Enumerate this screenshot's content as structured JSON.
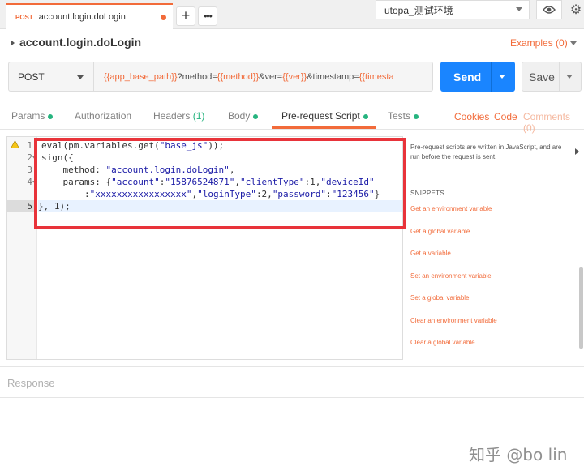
{
  "tab_bar": {
    "active_tab": {
      "method": "POST",
      "name": "account.login.doLogin"
    },
    "add_label": "+",
    "more_label": "•••",
    "environment": "utopa_测试环境"
  },
  "request": {
    "title": "account.login.doLogin",
    "examples_label": "Examples (0)",
    "method": "POST",
    "url_parts": [
      {
        "text": "{{app_base_path}}",
        "var": true
      },
      {
        "text": "?method=",
        "var": false
      },
      {
        "text": "{{method}}",
        "var": true
      },
      {
        "text": "&ver=",
        "var": false
      },
      {
        "text": "{{ver}}",
        "var": true
      },
      {
        "text": "&timestamp=",
        "var": false
      },
      {
        "text": "{{timesta",
        "var": true
      }
    ],
    "send_label": "Send",
    "save_label": "Save"
  },
  "subtabs": {
    "params": "Params",
    "authorization": "Authorization",
    "headers": "Headers",
    "headers_count": "(1)",
    "body": "Body",
    "prerequest": "Pre-request Script",
    "tests": "Tests",
    "cookies": "Cookies",
    "code": "Code",
    "comments": "Comments (0)"
  },
  "editor": {
    "line_numbers": [
      "1",
      "2",
      "3",
      "4",
      "",
      "5"
    ],
    "lines": [
      [
        {
          "t": "eval(pm.variables.get("
        },
        {
          "t": "\"base_js\"",
          "s": true
        },
        {
          "t": "));"
        }
      ],
      [
        {
          "t": "sign({"
        }
      ],
      [
        {
          "t": "    method: "
        },
        {
          "t": "\"account.login.doLogin\"",
          "s": true
        },
        {
          "t": ","
        }
      ],
      [
        {
          "t": "    params: {"
        },
        {
          "t": "\"account\"",
          "s": true
        },
        {
          "t": ":"
        },
        {
          "t": "\"15876524871\"",
          "s": true
        },
        {
          "t": ","
        },
        {
          "t": "\"clientType\"",
          "s": true
        },
        {
          "t": ":1,"
        },
        {
          "t": "\"deviceId\"",
          "s": true
        }
      ],
      [
        {
          "t": "        :"
        },
        {
          "t": "\"xxxxxxxxxxxxxxxxx\"",
          "s": true
        },
        {
          "t": ","
        },
        {
          "t": "\"loginType\"",
          "s": true
        },
        {
          "t": ":2,"
        },
        {
          "t": "\"password\"",
          "s": true
        },
        {
          "t": ":"
        },
        {
          "t": "\"123456\"",
          "s": true
        },
        {
          "t": "}"
        }
      ],
      [
        {
          "t": "}, 1);"
        }
      ]
    ]
  },
  "snippets": {
    "description": "Pre-request scripts are written in JavaScript, and are run before the request is sent.",
    "heading": "SNIPPETS",
    "items": [
      "Get an environment variable",
      "Get a global variable",
      "Get a variable",
      "Set an environment variable",
      "Set a global variable",
      "Clear an environment variable",
      "Clear a global variable"
    ]
  },
  "response": {
    "label": "Response"
  },
  "watermark": "知乎 @bo lin",
  "colors": {
    "accent": "#f26b3a",
    "send": "#1a85ff",
    "status_green": "#26b47f",
    "annotation_red": "#e8333a"
  }
}
